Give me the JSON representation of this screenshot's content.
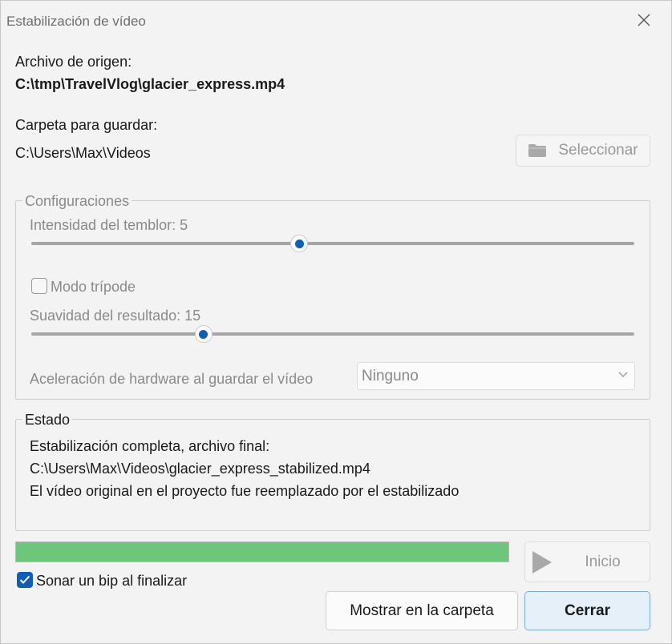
{
  "window": {
    "title": "Estabilización de vídeo"
  },
  "source": {
    "label": "Archivo de origen:",
    "path": "C:\\tmp\\TravelVlog\\glacier_express.mp4"
  },
  "save_folder": {
    "label": "Carpeta para guardar:",
    "path": "C:\\Users\\Max\\Videos",
    "select_button": "Seleccionar"
  },
  "settings": {
    "group_label": "Configuraciones",
    "shake_label": "Intensidad del temblor: 5",
    "shake_value": 5,
    "shake_min": 1,
    "shake_max": 10,
    "tripod_label": "Modo trípode",
    "tripod_checked": false,
    "smooth_label": "Suavidad del resultado: 15",
    "smooth_value": 15,
    "smooth_min": 1,
    "smooth_max": 50,
    "hw_label": "Aceleración de hardware al guardar el vídeo",
    "hw_value": "Ninguno"
  },
  "status": {
    "group_label": "Estado",
    "line1": "Estabilización completa, archivo final:",
    "line2": "C:\\Users\\Max\\Videos\\glacier_express_stabilized.mp4",
    "line3": "El vídeo original en el proyecto fue reemplazado por el estabilizado"
  },
  "progress": {
    "percent": 100
  },
  "buttons": {
    "start": "Inicio",
    "show_folder": "Mostrar en la carpeta",
    "close": "Cerrar"
  },
  "beep": {
    "label": "Sonar un bip al finalizar",
    "checked": true
  },
  "colors": {
    "accent": "#0f5fb8",
    "progress": "#6cc77b"
  }
}
